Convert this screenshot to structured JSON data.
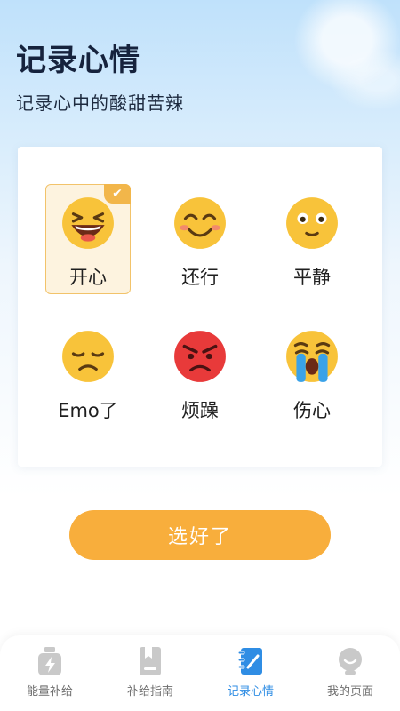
{
  "header": {
    "title": "记录心情",
    "subtitle": "记录心中的酸甜苦辣"
  },
  "moods": [
    {
      "label": "开心",
      "icon": "laughing-face-icon",
      "selected": true
    },
    {
      "label": "还行",
      "icon": "smiling-face-icon",
      "selected": false
    },
    {
      "label": "平静",
      "icon": "calm-face-icon",
      "selected": false
    },
    {
      "label": "Emo了",
      "icon": "sad-face-icon",
      "selected": false
    },
    {
      "label": "烦躁",
      "icon": "angry-face-icon",
      "selected": false
    },
    {
      "label": "伤心",
      "icon": "crying-face-icon",
      "selected": false
    }
  ],
  "confirm_label": "选好了",
  "tabs": [
    {
      "label": "能量补给",
      "icon": "energy-bottle-icon",
      "active": false
    },
    {
      "label": "补给指南",
      "icon": "guide-book-icon",
      "active": false
    },
    {
      "label": "记录心情",
      "icon": "mood-notebook-icon",
      "active": true
    },
    {
      "label": "我的页面",
      "icon": "profile-avatar-icon",
      "active": false
    }
  ],
  "colors": {
    "accent": "#f8ae3c",
    "selected_bg": "#fdf3df",
    "selected_border": "#f2c36a",
    "tab_active": "#2f8de4",
    "tab_inactive": "#c9c9c9"
  }
}
